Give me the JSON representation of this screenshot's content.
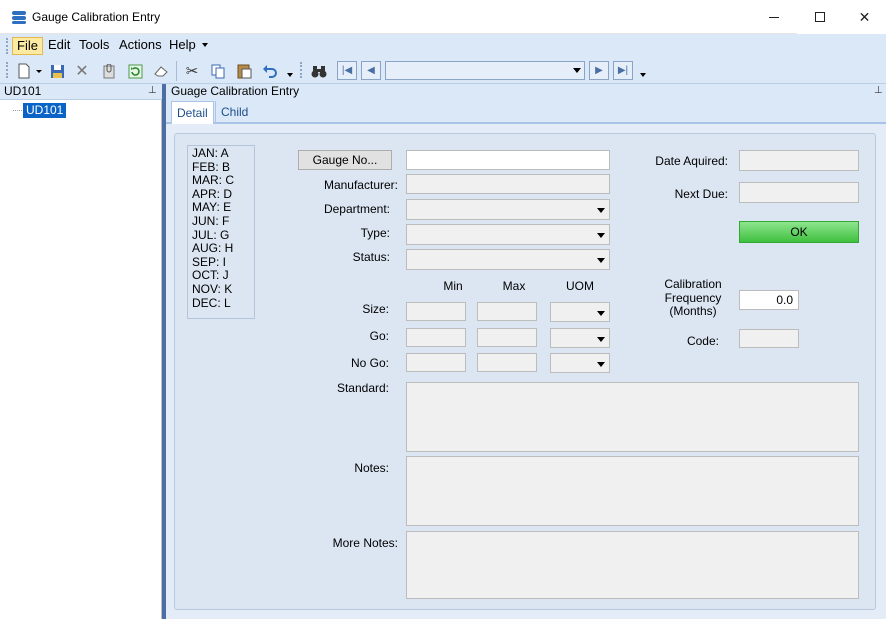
{
  "window": {
    "title": "Gauge Calibration Entry",
    "minimize": "—",
    "maximize": "☐",
    "close": "✕"
  },
  "menu": {
    "file": "File",
    "edit": "Edit",
    "tools": "Tools",
    "actions": "Actions",
    "help": "Help"
  },
  "toolbar": {
    "icons": [
      "new-icon",
      "save-icon",
      "delete-icon",
      "attach-icon",
      "refresh-icon",
      "eraser-icon",
      "cut-icon",
      "copy-icon",
      "paste-icon",
      "undo-icon",
      "binoculars-icon",
      "first-record-icon",
      "previous-record-icon",
      "next-record-icon",
      "last-record-icon"
    ],
    "nav_value": ""
  },
  "left_panel": {
    "header": "UD101",
    "tree_item": "UD101"
  },
  "right_panel": {
    "header": "Guage Calibration Entry"
  },
  "tabs": [
    {
      "label": "Detail",
      "active": true
    },
    {
      "label": "Child",
      "active": false
    }
  ],
  "months": [
    "JAN: A",
    "FEB: B",
    "MAR: C",
    "APR: D",
    "MAY: E",
    "JUN: F",
    "JUL: G",
    "AUG: H",
    "SEP: I",
    "OCT: J",
    "NOV: K",
    "DEC: L"
  ],
  "form": {
    "gauge_no_button": "Gauge No...",
    "gauge_no_value": "",
    "manufacturer_label": "Manufacturer:",
    "manufacturer_value": "",
    "department_label": "Department:",
    "type_label": "Type:",
    "status_label": "Status:",
    "col_min": "Min",
    "col_max": "Max",
    "col_uom": "UOM",
    "size_label": "Size:",
    "go_label": "Go:",
    "nogo_label": "No Go:",
    "standard_label": "Standard:",
    "notes_label": "Notes:",
    "more_notes_label": "More Notes:",
    "date_aquired_label": "Date Aquired:",
    "next_due_label": "Next Due:",
    "ok_button": "OK",
    "calib_label_1": "Calibration",
    "calib_label_2": "Frequency",
    "calib_label_3": "(Months)",
    "calib_value": "0.0",
    "code_label": "Code:"
  },
  "colors": {
    "accent": "#0a64c8",
    "ok_green": "#3fc03f",
    "chrome": "#dbe8f7"
  }
}
